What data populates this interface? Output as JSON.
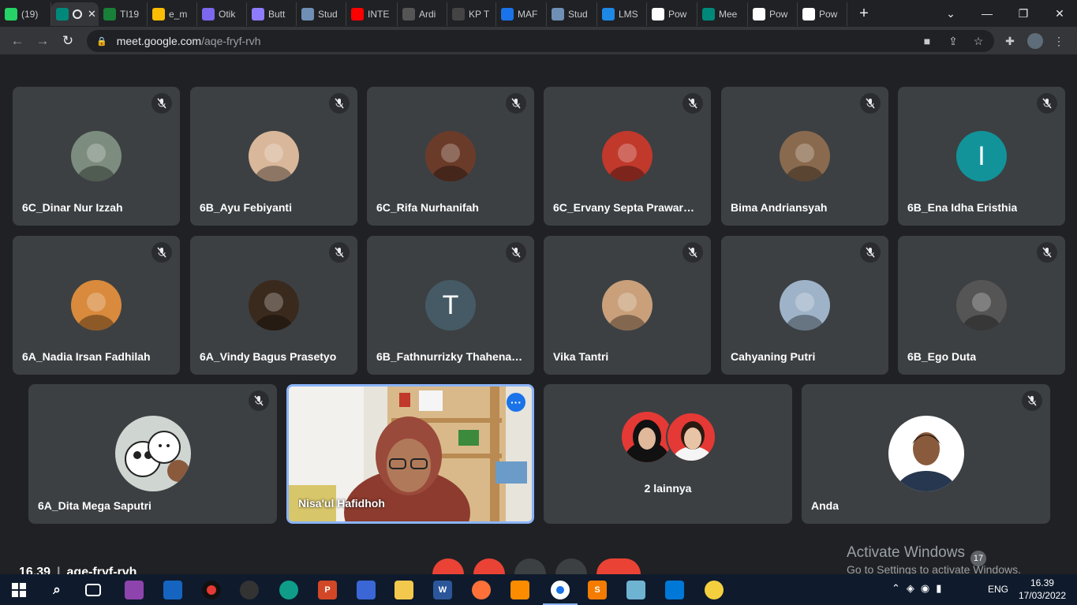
{
  "browser": {
    "tabs": [
      {
        "label": "(19)",
        "icon": "whatsapp-icon",
        "color": "#25d366"
      },
      {
        "label": "",
        "icon": "meet-icon",
        "color": "#00897b",
        "active": true
      },
      {
        "label": "TI19",
        "icon": "sheets-icon",
        "color": "#188038"
      },
      {
        "label": "e_m",
        "icon": "drive-icon",
        "color": "#fbbc04"
      },
      {
        "label": "Otik",
        "icon": "clickup-icon",
        "color": "#7b68ee"
      },
      {
        "label": "Butt",
        "icon": "heart-icon",
        "color": "#8e7cff"
      },
      {
        "label": "Stud",
        "icon": "study-icon",
        "color": "#6f8fb5"
      },
      {
        "label": "INTE",
        "icon": "youtube-icon",
        "color": "#ff0000"
      },
      {
        "label": "Ardi",
        "icon": "github-icon",
        "color": "#555555"
      },
      {
        "label": "KP T",
        "icon": "kp-icon",
        "color": "#444444"
      },
      {
        "label": "MAF",
        "icon": "maf-icon",
        "color": "#1a73e8"
      },
      {
        "label": "Stud",
        "icon": "study-icon",
        "color": "#6f8fb5"
      },
      {
        "label": "LMS",
        "icon": "lms-icon",
        "color": "#1e88e5"
      },
      {
        "label": "Pow",
        "icon": "globe-icon",
        "color": "#ffffff"
      },
      {
        "label": "Mee",
        "icon": "meet-icon",
        "color": "#00897b"
      },
      {
        "label": "Pow",
        "icon": "globe-icon",
        "color": "#ffffff"
      },
      {
        "label": "Pow",
        "icon": "globe-icon",
        "color": "#ffffff"
      }
    ],
    "url_host": "meet.google.com",
    "url_path": "/aqe-fryf-rvh"
  },
  "participants_row1": [
    {
      "name": "6C_Dinar Nur Izzah",
      "avatar_color": "#7c8c7e"
    },
    {
      "name": "6B_Ayu Febiyanti",
      "avatar_color": "#d9b79a"
    },
    {
      "name": "6C_Rifa Nurhanifah",
      "avatar_color": "#6b3b2a"
    },
    {
      "name": "6C_Ervany Septa Prawara ...",
      "avatar_color": "#c0392b"
    },
    {
      "name": "Bima Andriansyah",
      "avatar_color": "#8a6a4e"
    },
    {
      "name": "6B_Ena Idha Eristhia",
      "avatar_letter": "I",
      "avatar_color": "#12939a"
    }
  ],
  "participants_row2": [
    {
      "name": "6A_Nadia Irsan Fadhilah",
      "avatar_color": "#d98a3c"
    },
    {
      "name": "6A_Vindy Bagus Prasetyo",
      "avatar_color": "#3a2a1e"
    },
    {
      "name": "6B_Fathnurrizky Thahenar ...",
      "avatar_letter": "T",
      "avatar_color": "#455a64"
    },
    {
      "name": "Vika Tantri",
      "avatar_color": "#c9a07a"
    },
    {
      "name": "Cahyaning Putri",
      "avatar_color": "#9fb3c8"
    },
    {
      "name": "6B_Ego Duta",
      "avatar_color": "#555555"
    }
  ],
  "participants_row3": {
    "dita": {
      "name": "6A_Dita Mega Saputri"
    },
    "presenter": {
      "name": "Nisa'ul Hafidhoh"
    },
    "others": {
      "label": "2 lainnya"
    },
    "self": {
      "name": "Anda"
    }
  },
  "meeting": {
    "time": "16.39",
    "code": "aqe-fryf-rvh",
    "participant_count": "17"
  },
  "watermark": {
    "line1": "Activate Windows",
    "line2": "Go to Settings to activate Windows."
  },
  "taskbar": {
    "language": "ENG",
    "time": "16.39",
    "date": "17/03/2022"
  }
}
